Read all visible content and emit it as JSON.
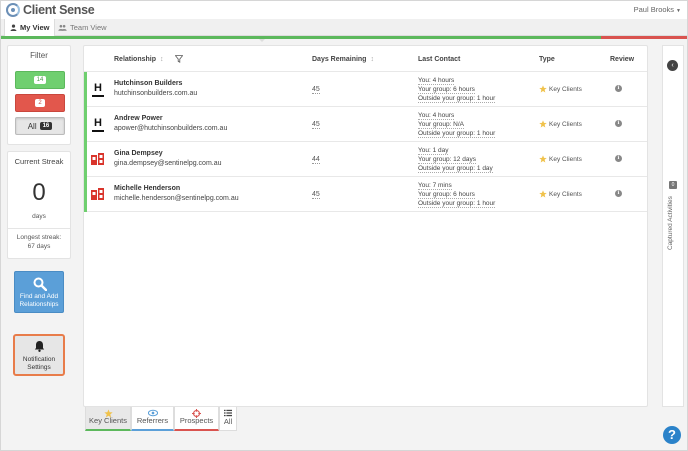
{
  "app": {
    "title": "Client Sense",
    "user": "Paul Brooks"
  },
  "tabs": {
    "my_view": "My View",
    "team_view": "Team View"
  },
  "filter": {
    "title": "Filter",
    "green_count": "14",
    "red_count": "2",
    "all_label": "All",
    "all_count": "16"
  },
  "streak": {
    "title": "Current Streak",
    "value": "0",
    "unit": "days",
    "longest_label": "Longest streak:",
    "longest_value": "67 days"
  },
  "actions": {
    "find_add": "Find and Add Relationships",
    "notification": "Notification Settings"
  },
  "table": {
    "headers": {
      "relationship": "Relationship",
      "days_remaining": "Days Remaining",
      "last_contact": "Last Contact",
      "type": "Type",
      "review": "Review"
    },
    "rows": [
      {
        "avatar": "H",
        "name": "Hutchinson Builders",
        "email": "hutchinsonbuilders.com.au",
        "days": "45",
        "you": "You: 4 hours",
        "group": "Your group: 6 hours",
        "outside": "Outside your group: 1 hour",
        "type": "Key Clients"
      },
      {
        "avatar": "H",
        "name": "Andrew Power",
        "email": "apower@hutchinsonbuilders.com.au",
        "days": "45",
        "you": "You: 4 hours",
        "group": "Your group: N/A",
        "outside": "Outside your group: 1 hour",
        "type": "Key Clients"
      },
      {
        "avatar": "logo",
        "name": "Gina Dempsey",
        "email": "gina.dempsey@sentinelpg.com.au",
        "days": "44",
        "you": "You: 1 day",
        "group": "Your group: 12 days",
        "outside": "Outside your group: 1 day",
        "type": "Key Clients"
      },
      {
        "avatar": "logo",
        "name": "Michelle Henderson",
        "email": "michelle.henderson@sentinelpg.com.au",
        "days": "45",
        "you": "You: 7 mins",
        "group": "Your group: 6 hours",
        "outside": "Outside your group: 1 hour",
        "type": "Key Clients"
      }
    ]
  },
  "bottom_tabs": {
    "key_clients": "Key Clients",
    "referrers": "Referrers",
    "prospects": "Prospects",
    "all": "All"
  },
  "right_panel": {
    "label": "Captured Activities",
    "badge": "0"
  },
  "help": "?",
  "colors": {
    "green": "#5cb85c",
    "red": "#d9534f",
    "blue": "#5b9fd8",
    "orange": "#e87c4a",
    "help_blue": "#2b82c9"
  }
}
